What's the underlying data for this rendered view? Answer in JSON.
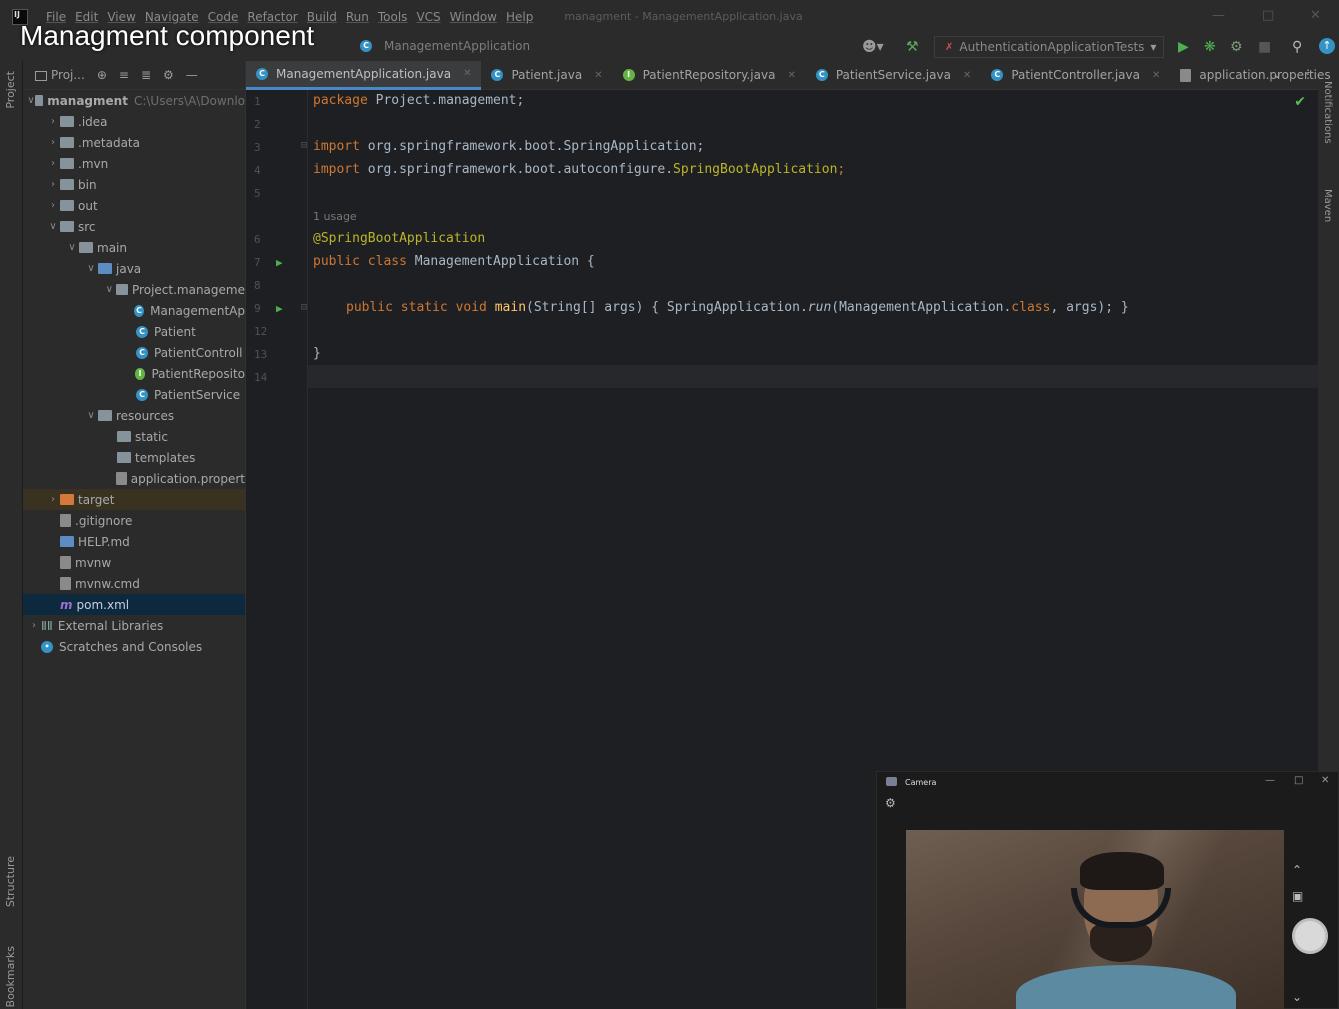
{
  "overlay_title": "Managment component",
  "menu": {
    "items": [
      "File",
      "Edit",
      "View",
      "Navigate",
      "Code",
      "Refactor",
      "Build",
      "Run",
      "Tools",
      "VCS",
      "Window",
      "Help"
    ],
    "window_title": "managment - ManagementApplication.java"
  },
  "navbar": {
    "breadcrumb_class": "ManagementApplication",
    "run_config": "AuthenticationApplicationTests"
  },
  "sidebar": {
    "left_labels": [
      "Project",
      "Structure",
      "Bookmarks"
    ],
    "right_labels": [
      "Notifications",
      "Maven"
    ]
  },
  "project": {
    "tool_label": "Proj...",
    "tree": [
      {
        "name": "managment",
        "extra": "C:\\Users\\A\\Downlo",
        "level": 0,
        "arrow": "open",
        "icon": "folder",
        "bold": true
      },
      {
        "name": ".idea",
        "level": 1,
        "arrow": "closed",
        "icon": "folder"
      },
      {
        "name": ".metadata",
        "level": 1,
        "arrow": "closed",
        "icon": "folder"
      },
      {
        "name": ".mvn",
        "level": 1,
        "arrow": "closed",
        "icon": "folder"
      },
      {
        "name": "bin",
        "level": 1,
        "arrow": "closed",
        "icon": "folder"
      },
      {
        "name": "out",
        "level": 1,
        "arrow": "closed",
        "icon": "folder"
      },
      {
        "name": "src",
        "level": 1,
        "arrow": "open",
        "icon": "folder"
      },
      {
        "name": "main",
        "level": 2,
        "arrow": "open",
        "icon": "folder"
      },
      {
        "name": "java",
        "level": 3,
        "arrow": "open",
        "icon": "blue"
      },
      {
        "name": "Project.manageme",
        "level": 4,
        "arrow": "open",
        "icon": "folder"
      },
      {
        "name": "ManagementAp",
        "level": 5,
        "arrow": "none",
        "icon": "class"
      },
      {
        "name": "Patient",
        "level": 5,
        "arrow": "none",
        "icon": "class"
      },
      {
        "name": "PatientControll",
        "level": 5,
        "arrow": "none",
        "icon": "class"
      },
      {
        "name": "PatientReposito",
        "level": 5,
        "arrow": "none",
        "icon": "iface"
      },
      {
        "name": "PatientService",
        "level": 5,
        "arrow": "none",
        "icon": "class"
      },
      {
        "name": "resources",
        "level": 3,
        "arrow": "open",
        "icon": "folder"
      },
      {
        "name": "static",
        "level": 4,
        "arrow": "none",
        "icon": "folder"
      },
      {
        "name": "templates",
        "level": 4,
        "arrow": "none",
        "icon": "folder"
      },
      {
        "name": "application.propert",
        "level": 4,
        "arrow": "none",
        "icon": "file"
      },
      {
        "name": "target",
        "level": 1,
        "arrow": "closed",
        "icon": "orange",
        "highlight": true
      },
      {
        "name": ".gitignore",
        "level": 1,
        "arrow": "none",
        "icon": "file"
      },
      {
        "name": "HELP.md",
        "level": 1,
        "arrow": "none",
        "icon": "blue"
      },
      {
        "name": "mvnw",
        "level": 1,
        "arrow": "none",
        "icon": "file"
      },
      {
        "name": "mvnw.cmd",
        "level": 1,
        "arrow": "none",
        "icon": "file"
      },
      {
        "name": "pom.xml",
        "level": 1,
        "arrow": "none",
        "icon": "maven",
        "selected": true
      },
      {
        "name": "External Libraries",
        "level": 0,
        "arrow": "closed",
        "icon": "lib"
      },
      {
        "name": "Scratches and Consoles",
        "level": 0,
        "arrow": "none",
        "icon": "scratch"
      }
    ]
  },
  "tabs": [
    {
      "label": "ManagementApplication.java",
      "icon": "class",
      "active": true
    },
    {
      "label": "Patient.java",
      "icon": "class"
    },
    {
      "label": "PatientRepository.java",
      "icon": "iface"
    },
    {
      "label": "PatientService.java",
      "icon": "class"
    },
    {
      "label": "PatientController.java",
      "icon": "class"
    },
    {
      "label": "application.properties",
      "icon": "file"
    }
  ],
  "editor": {
    "inlay_hint": "1 usage",
    "line_numbers": [
      "1",
      "2",
      "3",
      "4",
      "5",
      "6",
      "7",
      "8",
      "9",
      "12",
      "13",
      "14"
    ],
    "code": {
      "l1_kw": "package",
      "l1_rest": " Project.management;",
      "l3_kw": "import",
      "l3_rest": " org.springframework.boot.SpringApplication;",
      "l4_kw": "import",
      "l4_rest_a": " org.springframework.boot.autoconfigure.",
      "l4_rest_b": "SpringBootApplication",
      "l4_rest_c": ";",
      "l6_ann": "@SpringBootApplication",
      "l7_kw": "public class",
      "l7_rest": " ManagementApplication {",
      "l9_kw": "public static void",
      "l9_meth": " main",
      "l9_a": "(String[] args) { SpringApplication.",
      "l9_run": "run",
      "l9_b": "(ManagementApplication.",
      "l9_class": "class",
      "l9_c": ", args); }",
      "l13": "}"
    }
  },
  "camera": {
    "title": "Camera"
  },
  "colors": {
    "accent": "#4a88c7",
    "keyword": "#cc7832",
    "annotation": "#bbb529",
    "method": "#ffc66d",
    "run": "#4caf50"
  }
}
